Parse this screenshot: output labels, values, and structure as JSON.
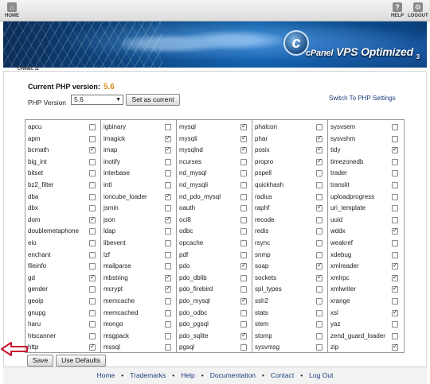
{
  "topbar": {
    "home": "HOME",
    "help": "HELP",
    "logout": "LOGOUT"
  },
  "banner": {
    "logo_brand": "cPanel",
    "logo_text": "VPS Optimized",
    "logo_version": "3"
  },
  "breadcrumb": "CPANEL 11",
  "php": {
    "current_label": "Current PHP version:",
    "current_value": "5.6",
    "version_label": "PHP Version",
    "selected_version": "5.6",
    "set_current_button": "Set as current",
    "switch_link": "Switch To PHP Settings"
  },
  "extensions": [
    [
      {
        "name": "apcu",
        "checked": false
      },
      {
        "name": "apm",
        "checked": false
      },
      {
        "name": "bcmath",
        "checked": true
      },
      {
        "name": "big_int",
        "checked": false
      },
      {
        "name": "bitset",
        "checked": false
      },
      {
        "name": "bz2_filter",
        "checked": false
      },
      {
        "name": "dba",
        "checked": false
      },
      {
        "name": "dbx",
        "checked": false
      },
      {
        "name": "dom",
        "checked": true
      },
      {
        "name": "doublemetaphone",
        "checked": false
      },
      {
        "name": "eio",
        "checked": false
      },
      {
        "name": "enchant",
        "checked": false
      },
      {
        "name": "fileinfo",
        "checked": false
      },
      {
        "name": "gd",
        "checked": true
      },
      {
        "name": "gender",
        "checked": false
      },
      {
        "name": "geoip",
        "checked": false
      },
      {
        "name": "gnupg",
        "checked": false
      },
      {
        "name": "haru",
        "checked": false
      },
      {
        "name": "htscanner",
        "checked": false
      },
      {
        "name": "http",
        "checked": true
      }
    ],
    [
      {
        "name": "igbinary",
        "checked": false
      },
      {
        "name": "imagick",
        "checked": true
      },
      {
        "name": "imap",
        "checked": true
      },
      {
        "name": "inotify",
        "checked": false
      },
      {
        "name": "interbase",
        "checked": false
      },
      {
        "name": "intl",
        "checked": false
      },
      {
        "name": "ioncube_loader",
        "checked": true
      },
      {
        "name": "jsmin",
        "checked": false
      },
      {
        "name": "json",
        "checked": true
      },
      {
        "name": "ldap",
        "checked": false
      },
      {
        "name": "libevent",
        "checked": false
      },
      {
        "name": "lzf",
        "checked": false
      },
      {
        "name": "mailparse",
        "checked": false
      },
      {
        "name": "mbstring",
        "checked": true
      },
      {
        "name": "mcrypt",
        "checked": true
      },
      {
        "name": "memcache",
        "checked": false
      },
      {
        "name": "memcached",
        "checked": false
      },
      {
        "name": "mongo",
        "checked": false
      },
      {
        "name": "msgpack",
        "checked": false
      },
      {
        "name": "mssql",
        "checked": false
      }
    ],
    [
      {
        "name": "mysql",
        "checked": true
      },
      {
        "name": "mysqli",
        "checked": true
      },
      {
        "name": "mysqlnd",
        "checked": true
      },
      {
        "name": "ncurses",
        "checked": false
      },
      {
        "name": "nd_mysql",
        "checked": false
      },
      {
        "name": "nd_mysqli",
        "checked": false
      },
      {
        "name": "nd_pdo_mysql",
        "checked": false
      },
      {
        "name": "oauth",
        "checked": false
      },
      {
        "name": "oci8",
        "checked": false
      },
      {
        "name": "odbc",
        "checked": false
      },
      {
        "name": "opcache",
        "checked": false
      },
      {
        "name": "pdf",
        "checked": false
      },
      {
        "name": "pdo",
        "checked": true
      },
      {
        "name": "pdo_dblib",
        "checked": false
      },
      {
        "name": "pdo_firebird",
        "checked": false
      },
      {
        "name": "pdo_mysql",
        "checked": true
      },
      {
        "name": "pdo_odbc",
        "checked": false
      },
      {
        "name": "pdo_pgsql",
        "checked": false
      },
      {
        "name": "pdo_sqlite",
        "checked": true
      },
      {
        "name": "pgsql",
        "checked": false
      }
    ],
    [
      {
        "name": "phalcon",
        "checked": false
      },
      {
        "name": "phar",
        "checked": true
      },
      {
        "name": "posix",
        "checked": true
      },
      {
        "name": "propro",
        "checked": true
      },
      {
        "name": "pspell",
        "checked": false
      },
      {
        "name": "quickhash",
        "checked": false
      },
      {
        "name": "radius",
        "checked": false
      },
      {
        "name": "raphf",
        "checked": true
      },
      {
        "name": "recode",
        "checked": false
      },
      {
        "name": "redis",
        "checked": false
      },
      {
        "name": "rsync",
        "checked": false
      },
      {
        "name": "snmp",
        "checked": false
      },
      {
        "name": "soap",
        "checked": true
      },
      {
        "name": "sockets",
        "checked": true
      },
      {
        "name": "spl_types",
        "checked": false
      },
      {
        "name": "ssh2",
        "checked": false
      },
      {
        "name": "stats",
        "checked": false
      },
      {
        "name": "stem",
        "checked": false
      },
      {
        "name": "stomp",
        "checked": false
      },
      {
        "name": "sysvmsg",
        "checked": false
      }
    ],
    [
      {
        "name": "sysvsem",
        "checked": false
      },
      {
        "name": "sysvshm",
        "checked": false
      },
      {
        "name": "tidy",
        "checked": true
      },
      {
        "name": "timezonedb",
        "checked": false
      },
      {
        "name": "trader",
        "checked": false
      },
      {
        "name": "translit",
        "checked": false
      },
      {
        "name": "uploadprogress",
        "checked": false
      },
      {
        "name": "uri_template",
        "checked": false
      },
      {
        "name": "uuid",
        "checked": false
      },
      {
        "name": "wddx",
        "checked": true
      },
      {
        "name": "weakref",
        "checked": false
      },
      {
        "name": "xdebug",
        "checked": false
      },
      {
        "name": "xmlreader",
        "checked": true
      },
      {
        "name": "xmlrpc",
        "checked": true
      },
      {
        "name": "xmlwriter",
        "checked": true
      },
      {
        "name": "xrange",
        "checked": false
      },
      {
        "name": "xsl",
        "checked": true
      },
      {
        "name": "yaz",
        "checked": false
      },
      {
        "name": "zend_guard_loader",
        "checked": false
      },
      {
        "name": "zip",
        "checked": true
      }
    ]
  ],
  "buttons": {
    "save": "Save",
    "use_defaults": "Use Defaults"
  },
  "footer": [
    "Home",
    "Trademarks",
    "Help",
    "Documentation",
    "Contact",
    "Log Out"
  ],
  "colors": {
    "version_accent": "#d68a1a",
    "arrow": "#c8102e",
    "link": "#1a3c7c"
  }
}
